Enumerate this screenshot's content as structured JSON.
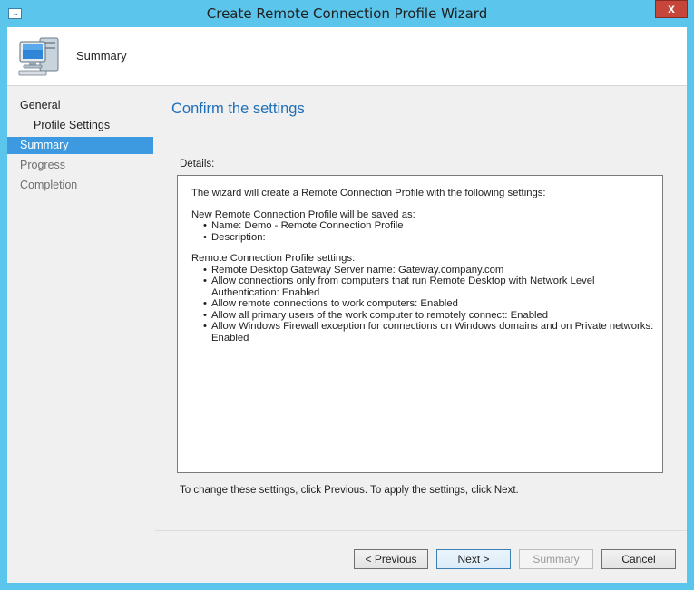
{
  "window": {
    "title": "Create Remote Connection Profile Wizard",
    "close_label": "x"
  },
  "header": {
    "title": "Summary",
    "icon": "computer-icon"
  },
  "nav": {
    "items": [
      {
        "label": "General",
        "state": "normal"
      },
      {
        "label": "Profile Settings",
        "state": "normal"
      },
      {
        "label": "Summary",
        "state": "active"
      },
      {
        "label": "Progress",
        "state": "disabled"
      },
      {
        "label": "Completion",
        "state": "disabled"
      }
    ]
  },
  "main": {
    "heading": "Confirm the settings",
    "details_label": "Details:",
    "intro": "The wizard will create a Remote Connection Profile with the following settings:",
    "save_heading": "New Remote Connection Profile will be saved as:",
    "save_items": [
      "Name: Demo - Remote Connection Profile",
      "Description:"
    ],
    "settings_heading": "Remote Connection Profile settings:",
    "settings_items": [
      "Remote Desktop Gateway Server name: Gateway.company.com",
      "Allow connections only from computers that run Remote Desktop with Network Level Authentication: Enabled",
      "Allow remote connections to work computers: Enabled",
      "Allow all primary users of the work computer to remotely connect: Enabled",
      "Allow Windows Firewall exception for connections on Windows domains and on Private networks: Enabled"
    ],
    "change_note": "To change these settings, click Previous. To apply the settings, click Next."
  },
  "buttons": {
    "previous": "< Previous",
    "next": "Next >",
    "summary": "Summary",
    "cancel": "Cancel"
  },
  "colors": {
    "titlebar": "#5bc5ec",
    "accent": "#3d9ae1",
    "heading": "#1f6fb8",
    "close": "#c7463a"
  }
}
